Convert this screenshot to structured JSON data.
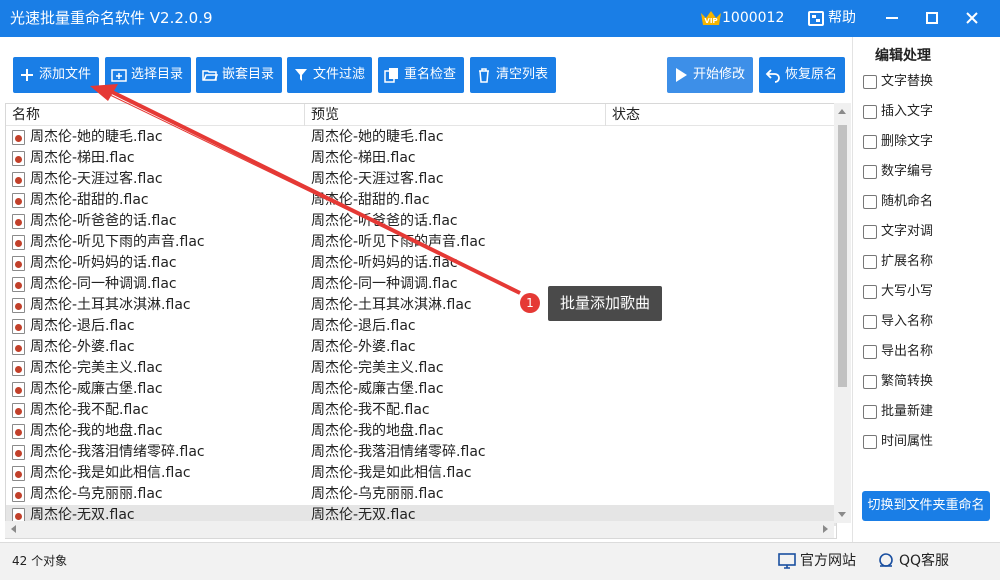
{
  "app": {
    "title": "光速批量重命名软件 V2.2.0.9",
    "user_id": "1000012",
    "help_label": "帮助"
  },
  "toolbar": {
    "add_file": "添加文件",
    "select_dir": "选择目录",
    "nested_dir": "嵌套目录",
    "file_filter": "文件过滤",
    "rename_check": "重名检查",
    "clear_list": "清空列表",
    "start_modify": "开始修改",
    "restore_name": "恢复原名"
  },
  "table": {
    "columns": [
      "名称",
      "预览",
      "状态"
    ],
    "rows": [
      {
        "name": "周杰伦-她的睫毛.flac",
        "preview": "周杰伦-她的睫毛.flac"
      },
      {
        "name": "周杰伦-梯田.flac",
        "preview": "周杰伦-梯田.flac"
      },
      {
        "name": "周杰伦-天涯过客.flac",
        "preview": "周杰伦-天涯过客.flac"
      },
      {
        "name": "周杰伦-甜甜的.flac",
        "preview": "周杰伦-甜甜的.flac"
      },
      {
        "name": "周杰伦-听爸爸的话.flac",
        "preview": "周杰伦-听爸爸的话.flac"
      },
      {
        "name": "周杰伦-听见下雨的声音.flac",
        "preview": "周杰伦-听见下雨的声音.flac"
      },
      {
        "name": "周杰伦-听妈妈的话.flac",
        "preview": "周杰伦-听妈妈的话.flac"
      },
      {
        "name": "周杰伦-同一种调调.flac",
        "preview": "周杰伦-同一种调调.flac"
      },
      {
        "name": "周杰伦-土耳其冰淇淋.flac",
        "preview": "周杰伦-土耳其冰淇淋.flac"
      },
      {
        "name": "周杰伦-退后.flac",
        "preview": "周杰伦-退后.flac"
      },
      {
        "name": "周杰伦-外婆.flac",
        "preview": "周杰伦-外婆.flac"
      },
      {
        "name": "周杰伦-完美主义.flac",
        "preview": "周杰伦-完美主义.flac"
      },
      {
        "name": "周杰伦-威廉古堡.flac",
        "preview": "周杰伦-威廉古堡.flac"
      },
      {
        "name": "周杰伦-我不配.flac",
        "preview": "周杰伦-我不配.flac"
      },
      {
        "name": "周杰伦-我的地盘.flac",
        "preview": "周杰伦-我的地盘.flac"
      },
      {
        "name": "周杰伦-我落泪情绪零碎.flac",
        "preview": "周杰伦-我落泪情绪零碎.flac"
      },
      {
        "name": "周杰伦-我是如此相信.flac",
        "preview": "周杰伦-我是如此相信.flac"
      },
      {
        "name": "周杰伦-乌克丽丽.flac",
        "preview": "周杰伦-乌克丽丽.flac"
      },
      {
        "name": "周杰伦-无双.flac",
        "preview": "周杰伦-无双.flac"
      }
    ]
  },
  "side_panel": {
    "title": "编辑处理",
    "items": [
      "文字替换",
      "插入文字",
      "删除文字",
      "数字编号",
      "随机命名",
      "文字对调",
      "扩展名称",
      "大写小写",
      "导入名称",
      "导出名称",
      "繁简转换",
      "批量新建",
      "时间属性"
    ],
    "switch_button": "切换到文件夹重命名"
  },
  "status": {
    "object_count": "42 个对象",
    "official_site": "官方网站",
    "qq_service": "QQ客服"
  },
  "annotation": {
    "badge": "1",
    "callout": "批量添加歌曲"
  },
  "colors": {
    "accent": "#1a7ee6",
    "arrow": "#e53935",
    "callout_bg": "#4a4a4a"
  }
}
